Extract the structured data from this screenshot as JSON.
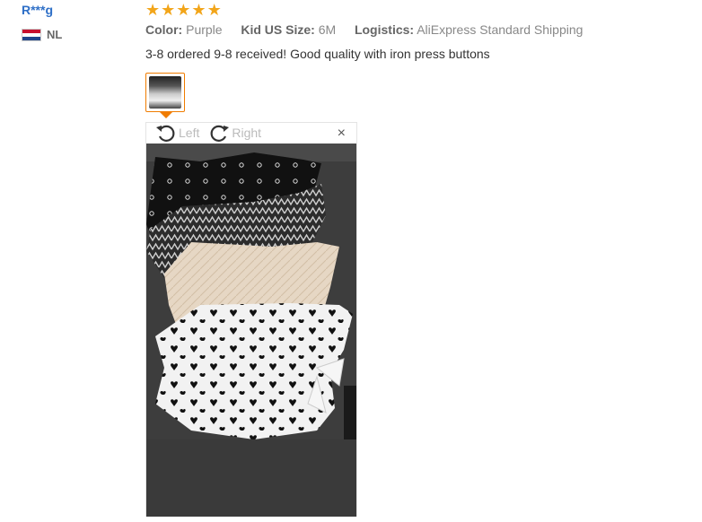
{
  "review": {
    "user_name": "R***g",
    "country_code": "NL",
    "rating": 5,
    "attributes": [
      {
        "key": "Color:",
        "value": "Purple"
      },
      {
        "key": "Kid US Size:",
        "value": "6M"
      },
      {
        "key": "Logistics:",
        "value": "AliExpress Standard Shipping"
      }
    ],
    "text": "3-8 ordered 9-8 received! Good quality with iron press buttons"
  },
  "viewer": {
    "rotate_left_label": "Left",
    "rotate_right_label": "Right",
    "close_glyph": "×"
  },
  "colors": {
    "star": "#f2a51a",
    "thumb_border": "#f07c00",
    "user_name": "#2e6fc7"
  },
  "icons": [
    "star-icon",
    "rotate-left-icon",
    "rotate-right-icon",
    "close-icon",
    "nl-flag-icon"
  ]
}
